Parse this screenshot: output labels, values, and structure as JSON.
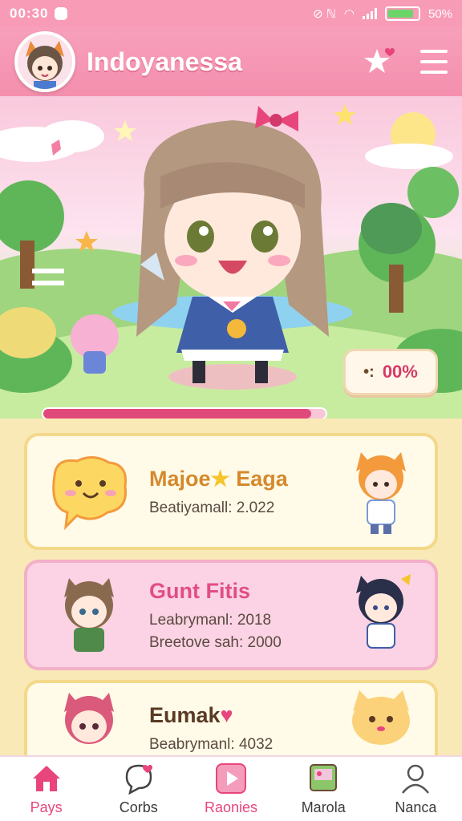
{
  "status_bar": {
    "time": "00:30",
    "battery_percent": "50%",
    "battery_level": 0.85
  },
  "header": {
    "title": "Indoyanessa"
  },
  "hero": {
    "badge_text": "00%",
    "badge_prefix": "•:",
    "progress": 0.95
  },
  "cards": [
    {
      "title": "Majoe",
      "title_suffix": "Eaga",
      "lines": [
        "Beatiyamall: 2.022"
      ]
    },
    {
      "title": "Gunt Fitis",
      "lines": [
        "Leabrymanl: 2018",
        "Breetove sah: 2000"
      ]
    },
    {
      "title": "Eumak",
      "lines": [
        "Beabrymanl: 4032"
      ]
    }
  ],
  "nav": [
    {
      "label": "Pays",
      "icon": "home-icon"
    },
    {
      "label": "Corbs",
      "icon": "chat-heart-icon"
    },
    {
      "label": "Raonies",
      "icon": "play-icon"
    },
    {
      "label": "Marola",
      "icon": "gallery-icon"
    },
    {
      "label": "Nanca",
      "icon": "profile-icon"
    }
  ],
  "colors": {
    "accent": "#e8457c",
    "header": "#f48fae",
    "card_gold": "#f4d88a",
    "card_pink": "#f3b0c9"
  }
}
